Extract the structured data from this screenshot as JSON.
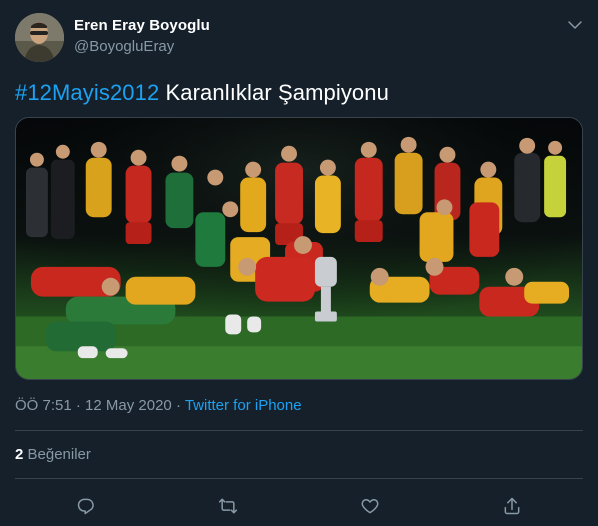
{
  "user": {
    "display_name": "Eren Eray Boyoglu",
    "handle": "@BoyogluEray"
  },
  "tweet": {
    "hashtag": "#12Mayis2012",
    "text": " Karanlıklar Şampiyonu"
  },
  "meta": {
    "time": "ÖÖ 7:51",
    "separator1": " · ",
    "date": "12 May 2020",
    "separator2": " · ",
    "source": "Twitter for iPhone"
  },
  "stats": {
    "likes_count": "2",
    "likes_label": " Beğeniler"
  },
  "icons": {
    "caret": "chevron-down-icon",
    "reply": "reply-icon",
    "retweet": "retweet-icon",
    "like": "like-icon",
    "share": "share-icon"
  },
  "colors": {
    "background": "#15202b",
    "accent": "#1da1f2",
    "secondary_text": "#8899a6",
    "divider": "#38444d"
  }
}
